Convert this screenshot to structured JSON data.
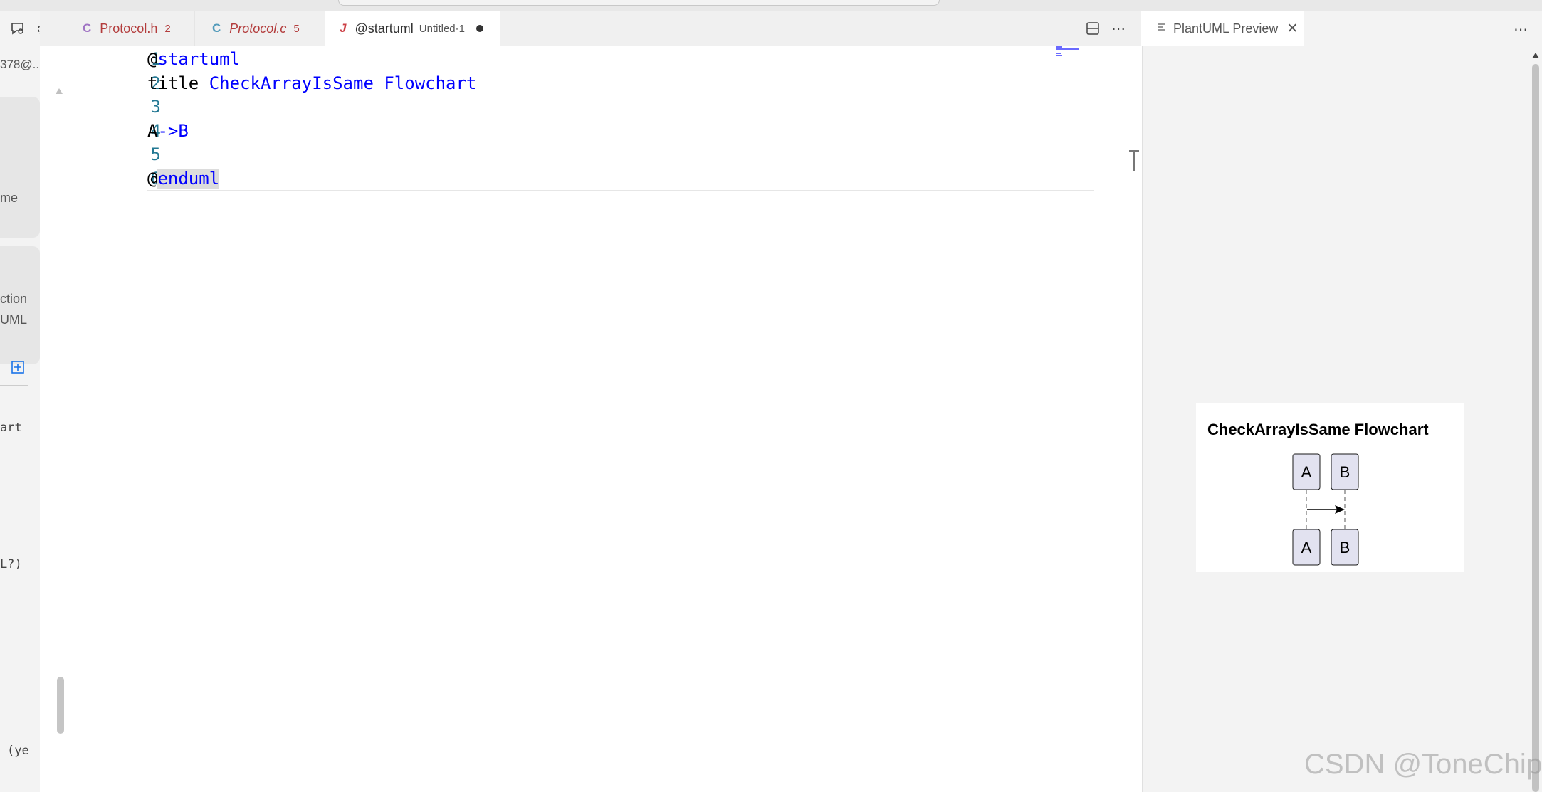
{
  "tabs": [
    {
      "icon": "C",
      "label": "Protocol.h",
      "badge": "2",
      "italic": false
    },
    {
      "icon": "C",
      "label": "Protocol.c",
      "badge": "5",
      "italic": true
    },
    {
      "icon": "J",
      "label": "@startuml",
      "subtitle": "Untitled-1",
      "dirty": true
    }
  ],
  "sidebar": {
    "session_label": "378@...",
    "fragments": [
      "me",
      "ction",
      "UML",
      "art",
      "L?)",
      "(ye"
    ]
  },
  "editor": {
    "line_numbers": [
      "1",
      "2",
      "3",
      "4",
      "5",
      "6"
    ],
    "line1": {
      "at": "@",
      "kw": "startuml"
    },
    "line2": {
      "plain": "title ",
      "kw": "CheckArrayIsSame Flowchart"
    },
    "line4": {
      "plain": "A",
      "kw": "->B"
    },
    "line6": {
      "at": "@",
      "kw": "enduml"
    }
  },
  "preview": {
    "tab_label": "PlantUML Preview",
    "diagram": {
      "title": "CheckArrayIsSame Flowchart",
      "participant_a": "A",
      "participant_b": "B"
    }
  },
  "watermark": "CSDN @ToneChip",
  "colors": {
    "keyword": "#0000ff",
    "line_number": "#237893",
    "c_icon_h": "#a074c4",
    "c_icon_c": "#519aba",
    "error_badge": "#b33c3c",
    "java_icon": "#cc3e44",
    "participant_fill": "#e2e2f0"
  },
  "icons": [
    "chat-icon",
    "gear-icon",
    "chevron-down-icon",
    "add-icon",
    "split-editor-icon",
    "more-icon",
    "preview-file-icon",
    "close-icon"
  ]
}
